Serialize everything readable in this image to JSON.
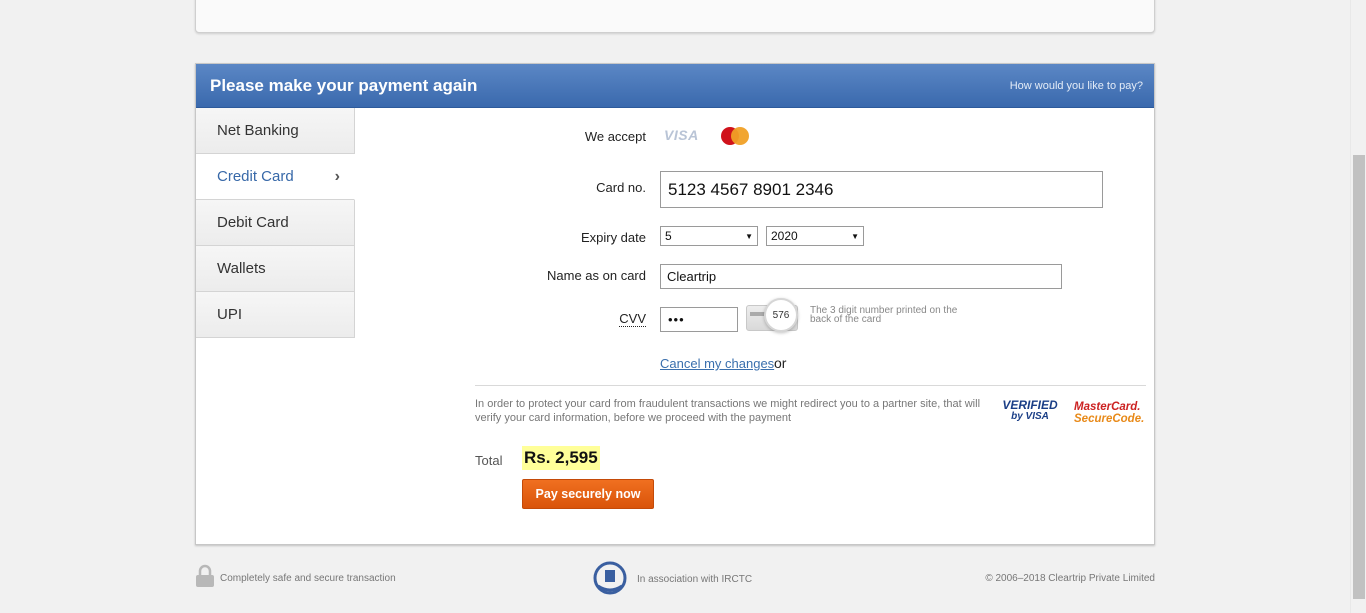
{
  "header": {
    "title": "Please make your payment again",
    "link": "How would you like to pay?"
  },
  "tabs": [
    {
      "label": "Net Banking"
    },
    {
      "label": "Credit Card"
    },
    {
      "label": "Debit Card"
    },
    {
      "label": "Wallets"
    },
    {
      "label": "UPI"
    }
  ],
  "active_tab": "Credit Card",
  "form": {
    "we_accept_label": "We accept",
    "visa_text": "VISA",
    "card_no_label": "Card no.",
    "card_no_value": "5123 4567 8901 2346",
    "expiry_label": "Expiry date",
    "expiry_month": "5",
    "expiry_year": "2020",
    "name_label": "Name as on card",
    "name_value": "Cleartrip",
    "cvv_label": "CVV",
    "cvv_value": "•••",
    "cvv_sample": "576",
    "cvv_help": "The 3 digit number printed on the back of the card",
    "cancel_link": "Cancel my changes",
    "or_text": "or"
  },
  "notice": "In order to protect your card from fraudulent transactions we might redirect you to a partner site, that will verify your card information, before we proceed with the payment",
  "logos": {
    "verified_line1": "VERIFIED",
    "verified_line2": "by VISA",
    "mc_line1": "MasterCard.",
    "mc_line2": "SecureCode."
  },
  "total": {
    "label": "Total",
    "value": "Rs. 2,595"
  },
  "pay_button": "Pay securely now",
  "footer": {
    "safe_text": "Completely safe and secure transaction",
    "irctc_text": "In association with IRCTC",
    "copyright": "© 2006–2018 Cleartrip Private Limited"
  },
  "colors": {
    "header_blue": "#3a69ad",
    "pay_orange": "#e0600f",
    "link_blue": "#3a6fad",
    "total_highlight": "#ffff99"
  }
}
